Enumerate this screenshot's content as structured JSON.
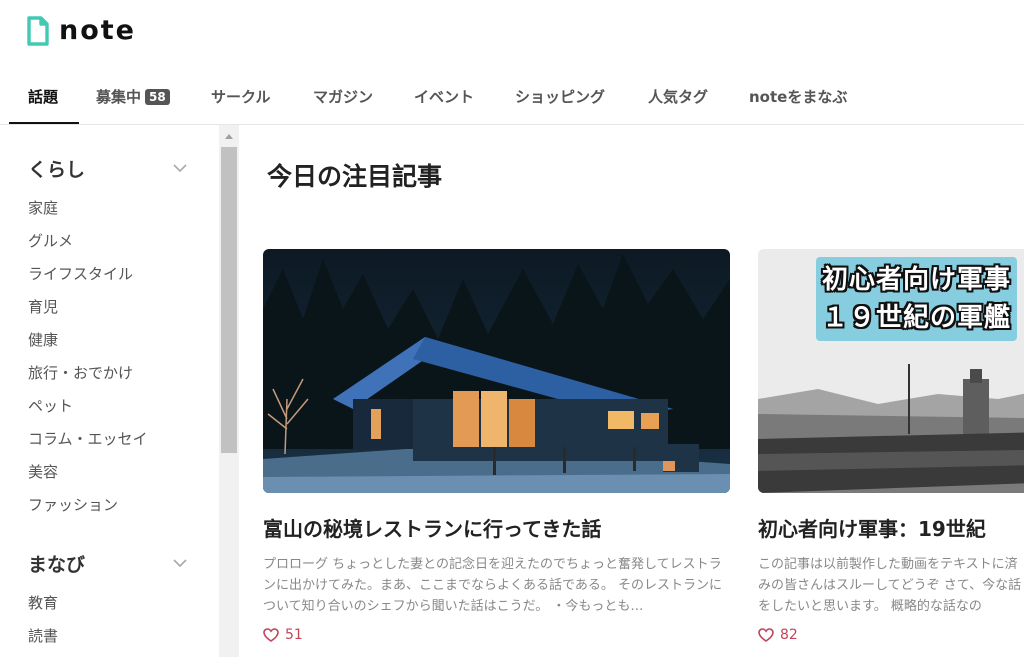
{
  "brand": {
    "name": "note",
    "accent": "#41c9b4"
  },
  "nav": {
    "tabs": [
      {
        "label": "話題",
        "active": true
      },
      {
        "label": "募集中",
        "badge": "58"
      },
      {
        "label": "サークル"
      },
      {
        "label": "マガジン"
      },
      {
        "label": "イベント"
      },
      {
        "label": "ショッピング"
      },
      {
        "label": "人気タグ"
      },
      {
        "label": "noteをまなぶ"
      }
    ]
  },
  "sidebar": {
    "sections": [
      {
        "title": "くらし",
        "items": [
          "家庭",
          "グルメ",
          "ライフスタイル",
          "育児",
          "健康",
          "旅行・おでかけ",
          "ペット",
          "コラム・エッセイ",
          "美容",
          "ファッション"
        ]
      },
      {
        "title": "まなび",
        "items": [
          "教育",
          "読書"
        ]
      }
    ]
  },
  "main": {
    "section_title": "今日の注目記事",
    "cards": [
      {
        "title": "富山の秘境レストランに行ってきた話",
        "description": "プロローグ ちょっとした妻との記念日を迎えたのでちょっと奮発してレストランに出かけてみた。まあ、ここまでならよくある話である。 そのレストランについて知り合いのシェフから聞いた話はこうだ。 ・今もっとも…",
        "likes": "51",
        "image": "night-cabin-photo"
      },
      {
        "title": "初心者向け軍事：19世紀",
        "description": "この記事は以前製作した動画をテキストに済みの皆さんはスルーしてどうぞ さて、今な話をしたいと思います。 概略的な話なの",
        "likes": "82",
        "image": "warship-photo",
        "image_caption_1": "初心者向け軍事",
        "image_caption_2": "１９世紀の軍艦"
      }
    ]
  },
  "colors": {
    "heart": "#c2455a",
    "badge": "#555555",
    "scrollbar_thumb": "#c1c1c1"
  }
}
